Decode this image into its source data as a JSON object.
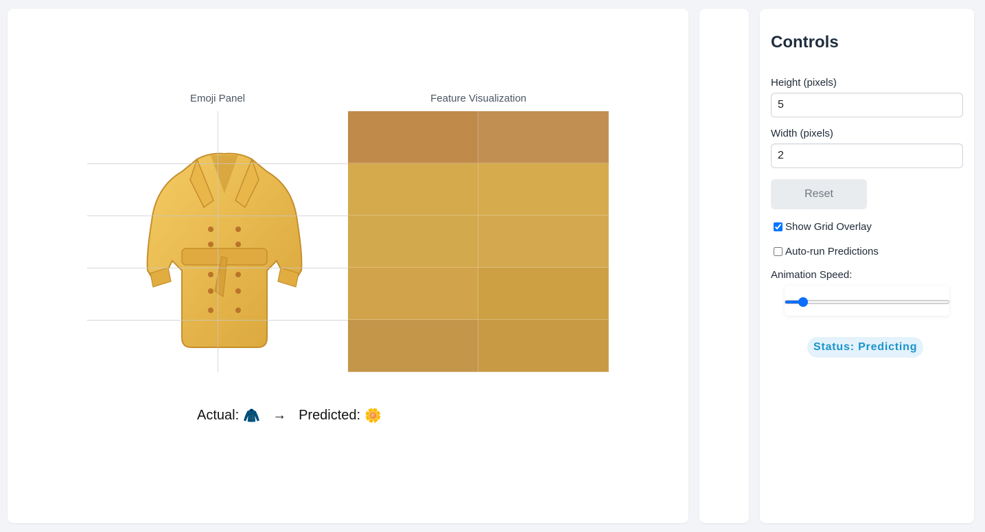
{
  "emoji_panel": {
    "title": "Emoji Panel",
    "emoji": "🧥",
    "grid_rows": 5,
    "grid_cols": 2
  },
  "feature_visualization": {
    "title": "Feature Visualization",
    "cells": [
      [
        "#c08a4b",
        "#c28f52"
      ],
      [
        "#d5aa4d",
        "#d6ab4d"
      ],
      [
        "#d3a94e",
        "#d4a84f"
      ],
      [
        "#d1a34b",
        "#cca043"
      ],
      [
        "#c4964a",
        "#c89a43"
      ]
    ]
  },
  "prediction": {
    "actual_label": "Actual:",
    "actual_emoji": "🧥",
    "arrow": "→",
    "predicted_label": "Predicted:",
    "predicted_emoji": "🌼"
  },
  "controls": {
    "title": "Controls",
    "height_label": "Height (pixels)",
    "height_value": "5",
    "width_label": "Width (pixels)",
    "width_value": "2",
    "reset_label": "Reset",
    "show_grid_label": "Show Grid Overlay",
    "show_grid_checked": true,
    "auto_run_label": "Auto-run Predictions",
    "auto_run_checked": false,
    "animation_speed_label": "Animation Speed:",
    "animation_speed_fraction": 0.09,
    "status_text": "Status: Predicting"
  },
  "colors": {
    "accent": "#0d6efd",
    "status_text": "#1a93cc",
    "status_bg": "#e3f2fb"
  }
}
